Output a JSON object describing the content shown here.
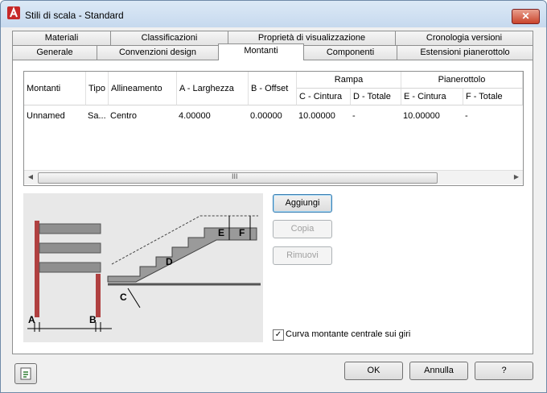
{
  "window": {
    "title": "Stili di scala - Standard",
    "close_label": "✕"
  },
  "tabs_row1": [
    "Materiali",
    "Classificazioni",
    "Proprietà di visualizzazione",
    "Cronologia versioni"
  ],
  "tabs_row2": [
    "Generale",
    "Convenzioni design",
    "Montanti",
    "Componenti",
    "Estensioni pianerottolo"
  ],
  "active_tab": "Montanti",
  "grid": {
    "columns": [
      "Montanti",
      "Tipo",
      "Allineamento",
      "A - Larghezza",
      "B - Offset"
    ],
    "group_rampa": "Rampa",
    "group_pianerottolo": "Pianerottolo",
    "subcolumns": [
      "C - Cintura",
      "D - Totale",
      "E - Cintura",
      "F - Totale"
    ],
    "row": [
      "Unnamed",
      "Sa...",
      "Centro",
      "4.00000",
      "0.00000",
      "10.00000",
      "-",
      "10.00000",
      "-"
    ],
    "scroll_grip": "III"
  },
  "illustration": {
    "labels": [
      "A",
      "B",
      "C",
      "D",
      "E",
      "F"
    ]
  },
  "buttons": {
    "add": "Aggiungi",
    "copy": "Copia",
    "remove": "Rimuovi",
    "ok": "OK",
    "cancel": "Annulla",
    "help": "?"
  },
  "checkbox": {
    "label": "Curva montante centrale sui giri",
    "checked": true,
    "mark": "✓"
  }
}
